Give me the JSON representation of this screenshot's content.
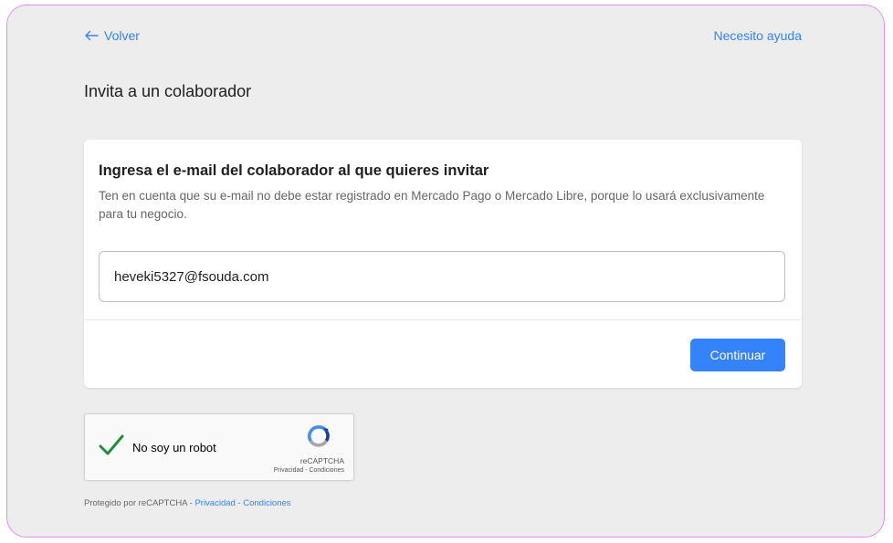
{
  "nav": {
    "back_label": "Volver",
    "help_label": "Necesito ayuda"
  },
  "page": {
    "title": "Invita a un colaborador"
  },
  "card": {
    "heading": "Ingresa el e-mail del colaborador al que quieres invitar",
    "description": "Ten en cuenta que su e-mail no debe estar registrado en Mercado Pago o Mercado Libre, porque lo usará exclusivamente para tu negocio.",
    "email_value": "heveki5327@fsouda.com",
    "continue_label": "Continuar"
  },
  "recaptcha": {
    "checkbox_label": "No soy un robot",
    "brand": "reCAPTCHA",
    "links": "Privacidad - Condiciones",
    "checked": true
  },
  "footnote": {
    "prefix": "Protegido por reCAPTCHA - ",
    "privacy": "Privacidad",
    "separator": " - ",
    "terms": "Condiciones"
  },
  "colors": {
    "accent": "#3483fa",
    "background": "#ededed",
    "frame_border": "#e58ef0",
    "check": "#1e8e3e"
  },
  "icons": {
    "back": "arrow-left-icon",
    "check": "check-icon",
    "recaptcha": "recaptcha-logo-icon"
  }
}
